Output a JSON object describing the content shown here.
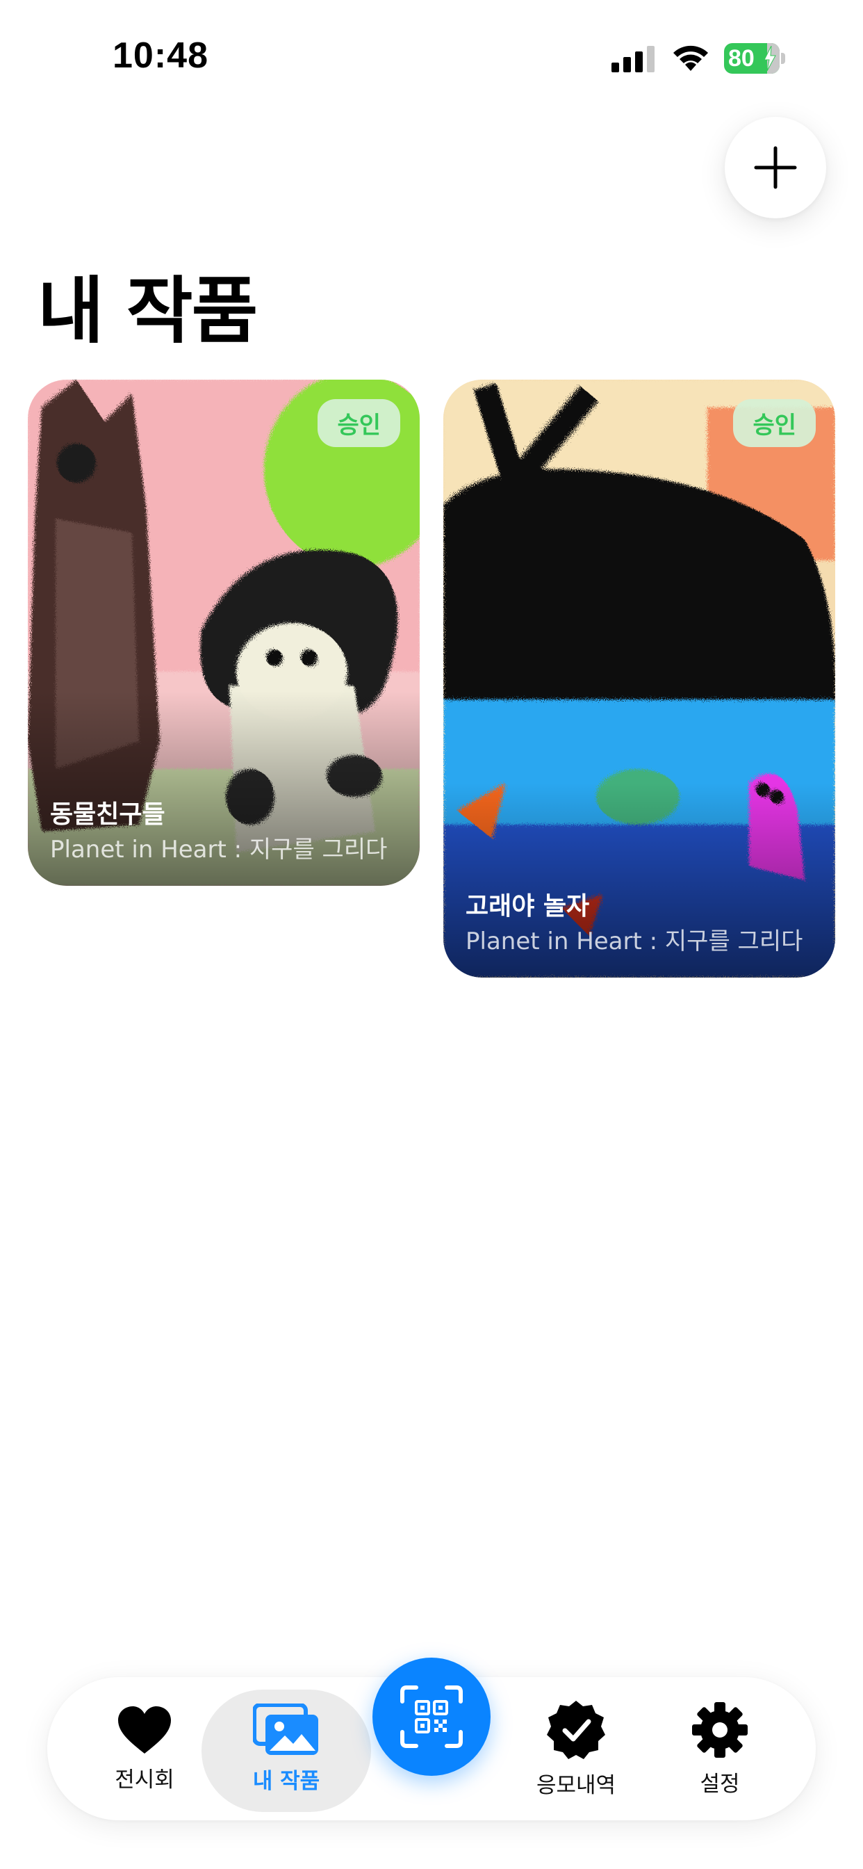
{
  "status_bar": {
    "time": "10:48",
    "battery_level": "80",
    "icons": [
      "cellular-signal-icon",
      "wifi-icon",
      "battery-charging-icon"
    ]
  },
  "header": {
    "title": "내 작품",
    "add_button_icon": "plus-icon"
  },
  "artworks": [
    {
      "title": "동물친구들",
      "exhibition": "Planet in Heart : 지구를 그리다",
      "status": "승인"
    },
    {
      "title": "고래야 놀자",
      "exhibition": "Planet in Heart : 지구를 그리다",
      "status": "승인"
    }
  ],
  "tab_bar": {
    "active_tab": "내 작품",
    "tabs": [
      {
        "label": "전시회",
        "icon": "heart-icon"
      },
      {
        "label": "내 작품",
        "icon": "photos-icon"
      },
      {
        "label": "응모내역",
        "icon": "checkmark-seal-icon"
      },
      {
        "label": "설정",
        "icon": "gear-icon"
      }
    ],
    "center_button_icon": "qr-scan-icon"
  },
  "colors": {
    "accent": "#0a84ff",
    "approved_badge_text": "#34c759",
    "approved_badge_bg": "#d5f1d5",
    "battery": "#34c759"
  }
}
